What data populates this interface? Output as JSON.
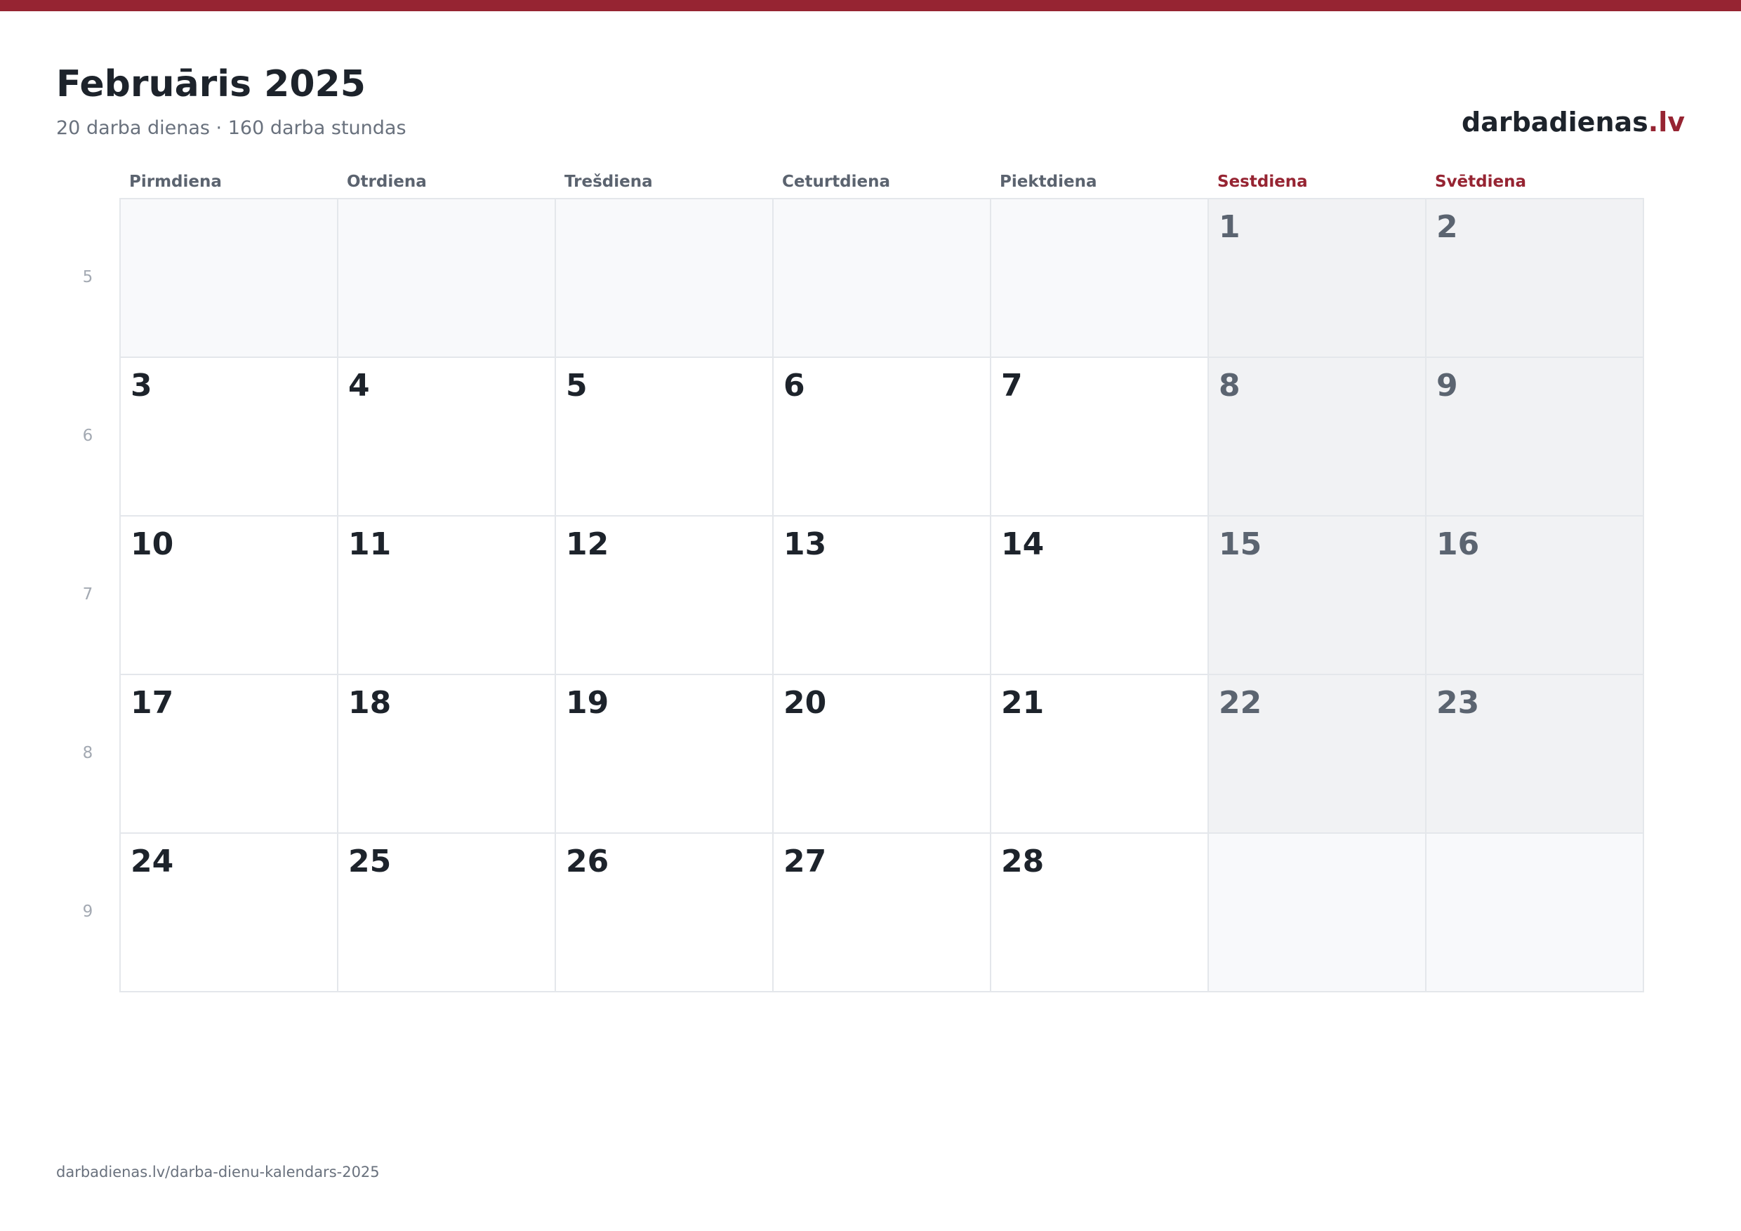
{
  "header": {
    "title": "Februāris 2025",
    "subtitle": "20 darba dienas · 160 darba stundas"
  },
  "brand": {
    "name": "darbadienas",
    "tld": ".lv"
  },
  "weekdays": [
    {
      "label": "Pirmdiena",
      "weekend": false
    },
    {
      "label": "Otrdiena",
      "weekend": false
    },
    {
      "label": "Trešdiena",
      "weekend": false
    },
    {
      "label": "Ceturtdiena",
      "weekend": false
    },
    {
      "label": "Piektdiena",
      "weekend": false
    },
    {
      "label": "Sestdiena",
      "weekend": true
    },
    {
      "label": "Svētdiena",
      "weekend": true
    }
  ],
  "weeks": [
    {
      "number": "5",
      "days": [
        "",
        "",
        "",
        "",
        "",
        "1",
        "2"
      ]
    },
    {
      "number": "6",
      "days": [
        "3",
        "4",
        "5",
        "6",
        "7",
        "8",
        "9"
      ]
    },
    {
      "number": "7",
      "days": [
        "10",
        "11",
        "12",
        "13",
        "14",
        "15",
        "16"
      ]
    },
    {
      "number": "8",
      "days": [
        "17",
        "18",
        "19",
        "20",
        "21",
        "22",
        "23"
      ]
    },
    {
      "number": "9",
      "days": [
        "24",
        "25",
        "26",
        "27",
        "28",
        "",
        ""
      ]
    }
  ],
  "footer": {
    "url": "darbadienas.lv/darba-dienu-kalendars-2025"
  },
  "colors": {
    "accent": "#962432",
    "text": "#1d232b",
    "muted": "#69717d",
    "weekend_cell": "#f1f2f4",
    "empty_cell": "#f8f9fb",
    "border": "#e4e7eb"
  }
}
